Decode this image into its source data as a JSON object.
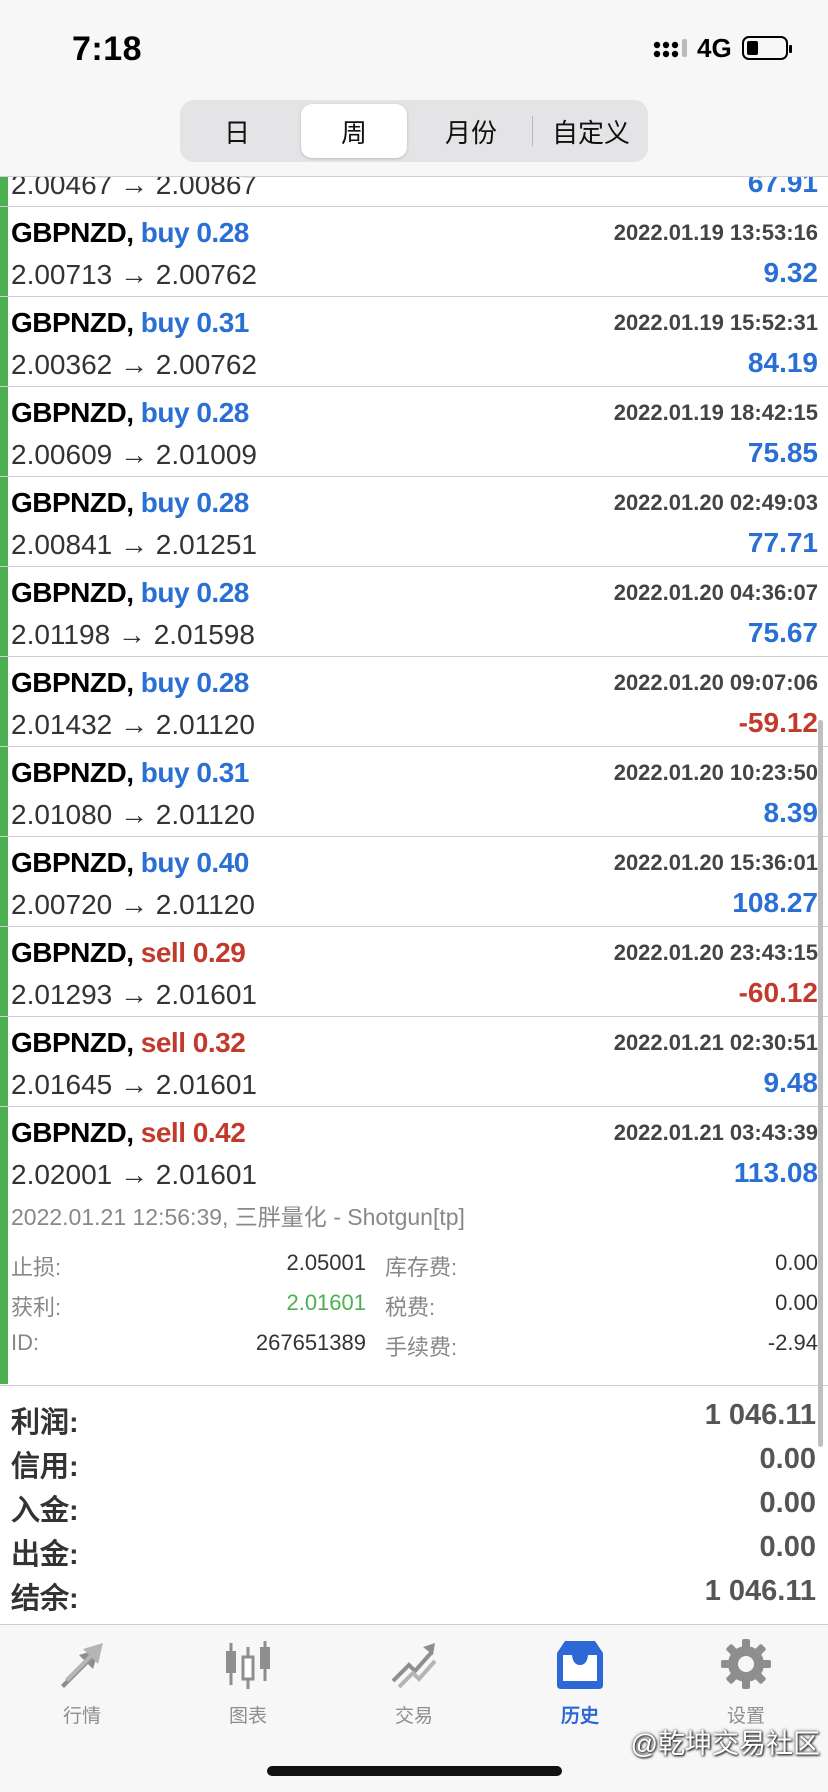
{
  "status_bar": {
    "time": "7:18",
    "network": "4G"
  },
  "period_tabs": [
    {
      "label": "日",
      "active": false
    },
    {
      "label": "周",
      "active": true
    },
    {
      "label": "月份",
      "active": false
    },
    {
      "label": "自定义",
      "active": false
    }
  ],
  "partial_row": {
    "price": "2.00467 → 2.00867",
    "profit": "67.91"
  },
  "trades": [
    {
      "symbol": "GBPNZD,",
      "side": "buy",
      "volume": "0.28",
      "datetime": "2022.01.19 13:53:16",
      "prices": "2.00713 → 2.00762",
      "profit": "9.32"
    },
    {
      "symbol": "GBPNZD,",
      "side": "buy",
      "volume": "0.31",
      "datetime": "2022.01.19 15:52:31",
      "prices": "2.00362 → 2.00762",
      "profit": "84.19"
    },
    {
      "symbol": "GBPNZD,",
      "side": "buy",
      "volume": "0.28",
      "datetime": "2022.01.19 18:42:15",
      "prices": "2.00609 → 2.01009",
      "profit": "75.85"
    },
    {
      "symbol": "GBPNZD,",
      "side": "buy",
      "volume": "0.28",
      "datetime": "2022.01.20 02:49:03",
      "prices": "2.00841 → 2.01251",
      "profit": "77.71"
    },
    {
      "symbol": "GBPNZD,",
      "side": "buy",
      "volume": "0.28",
      "datetime": "2022.01.20 04:36:07",
      "prices": "2.01198 → 2.01598",
      "profit": "75.67"
    },
    {
      "symbol": "GBPNZD,",
      "side": "buy",
      "volume": "0.28",
      "datetime": "2022.01.20 09:07:06",
      "prices": "2.01432 → 2.01120",
      "profit": "-59.12"
    },
    {
      "symbol": "GBPNZD,",
      "side": "buy",
      "volume": "0.31",
      "datetime": "2022.01.20 10:23:50",
      "prices": "2.01080 → 2.01120",
      "profit": "8.39"
    },
    {
      "symbol": "GBPNZD,",
      "side": "buy",
      "volume": "0.40",
      "datetime": "2022.01.20 15:36:01",
      "prices": "2.00720 → 2.01120",
      "profit": "108.27"
    },
    {
      "symbol": "GBPNZD,",
      "side": "sell",
      "volume": "0.29",
      "datetime": "2022.01.20 23:43:15",
      "prices": "2.01293 → 2.01601",
      "profit": "-60.12"
    },
    {
      "symbol": "GBPNZD,",
      "side": "sell",
      "volume": "0.32",
      "datetime": "2022.01.21 02:30:51",
      "prices": "2.01645 → 2.01601",
      "profit": "9.48"
    },
    {
      "symbol": "GBPNZD,",
      "side": "sell",
      "volume": "0.42",
      "datetime": "2022.01.21 03:43:39",
      "prices": "2.02001 → 2.01601",
      "profit": "113.08"
    }
  ],
  "detail": {
    "comment": "2022.01.21 12:56:39, 三胖量化 - Shotgun[tp]",
    "stop_loss_label": "止损:",
    "stop_loss": "2.05001",
    "take_profit_label": "获利:",
    "take_profit": "2.01601",
    "id_label": "ID:",
    "id": "267651389",
    "swap_label": "库存费:",
    "swap": "0.00",
    "tax_label": "税费:",
    "tax": "0.00",
    "fee_label": "手续费:",
    "fee": "-2.94"
  },
  "summary": {
    "profit_label": "利润:",
    "profit": "1 046.11",
    "credit_label": "信用:",
    "credit": "0.00",
    "deposit_label": "入金:",
    "deposit": "0.00",
    "withdrawal_label": "出金:",
    "withdrawal": "0.00",
    "balance_label": "结余:",
    "balance": "1 046.11"
  },
  "tabbar": [
    {
      "label": "行情",
      "icon": "quotes-icon",
      "active": false
    },
    {
      "label": "图表",
      "icon": "chart-icon",
      "active": false
    },
    {
      "label": "交易",
      "icon": "trade-icon",
      "active": false
    },
    {
      "label": "历史",
      "icon": "history-icon",
      "active": true
    },
    {
      "label": "设置",
      "icon": "settings-icon",
      "active": false
    }
  ],
  "watermark": "@乾坤交易社区",
  "colors": {
    "buy": "#2a6fd4",
    "sell": "#c23a2b",
    "green": "#4caf50",
    "active_tab": "#2c68d6",
    "inactive": "#8e8e8e"
  }
}
